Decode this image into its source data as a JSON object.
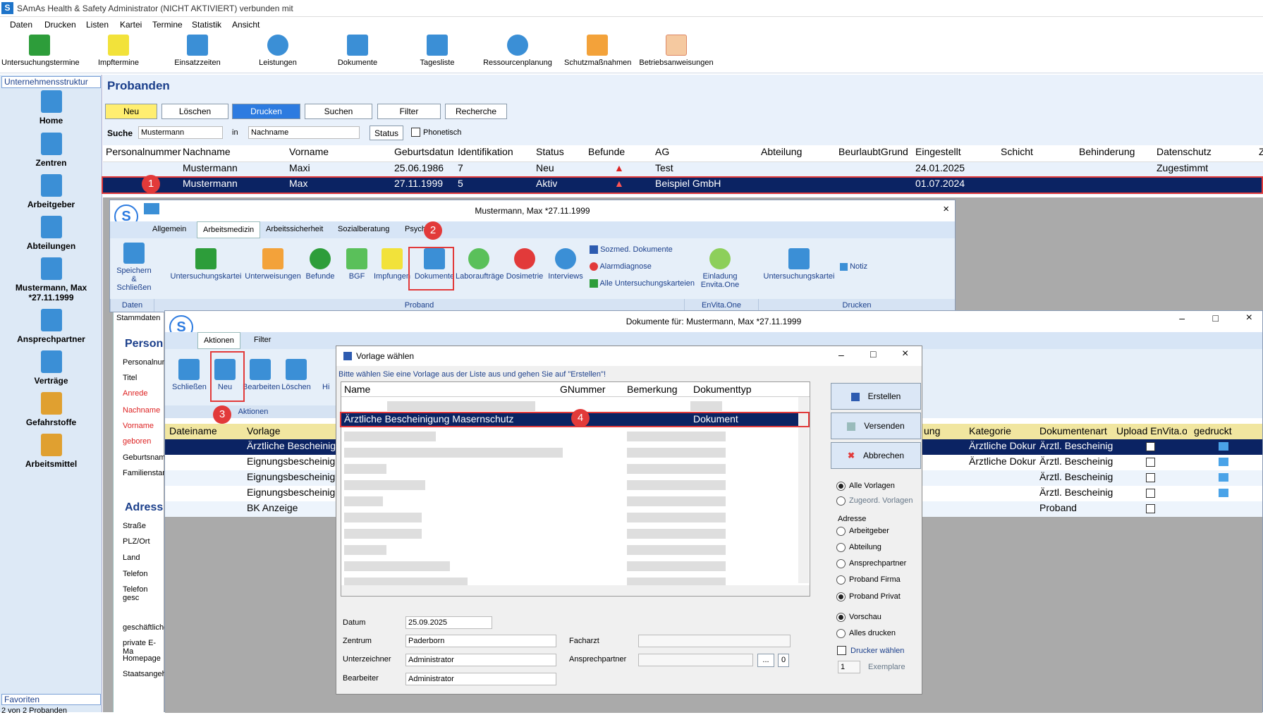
{
  "window": {
    "title": "SAmAs Health & Safety  Administrator (NICHT AKTIVIERT)  verbunden mit"
  },
  "menu": [
    "Daten",
    "Drucken",
    "Listen",
    "Kartei",
    "Termine",
    "Statistik",
    "Ansicht"
  ],
  "toolbar": [
    "Untersuchungstermine",
    "Impftermine",
    "Einsatzzeiten",
    "Leistungen",
    "Dokumente",
    "Tagesliste",
    "Ressourcenplanung",
    "Schutzmaßnahmen",
    "Betriebsanweisungen"
  ],
  "nav": {
    "header": "Unternehmensstruktur",
    "items": [
      "Home",
      "Zentren",
      "Arbeitgeber",
      "Abteilungen",
      "Mustermann, Max *27.11.1999",
      "Ansprechpartner",
      "Verträge",
      "Gefahrstoffe",
      "Arbeitsmittel"
    ],
    "favorites": "Favoriten",
    "status": "2 von 2 Probanden"
  },
  "probanden": {
    "title": "Probanden",
    "buttons": {
      "neu": "Neu",
      "loeschen": "Löschen",
      "drucken": "Drucken",
      "suchen": "Suchen",
      "filter": "Filter",
      "recherche": "Recherche"
    },
    "search": {
      "label": "Suche",
      "value": "Mustermann",
      "in_label": "in",
      "field": "Nachname",
      "status": "Status",
      "phonetisch": "Phonetisch"
    },
    "columns": [
      "Personalnummer",
      "Nachname",
      "Vorname",
      "Geburtsdatum",
      "Identifikation",
      "Status",
      "Befunde",
      "AG",
      "Abteilung",
      "BeurlaubtGrund",
      "Eingestellt",
      "Schicht",
      "Behinderung",
      "Datenschutz",
      "Z"
    ],
    "rows": [
      {
        "nachname": "Mustermann",
        "vorname": "Maxi",
        "geb": "25.06.1986",
        "id": "7",
        "status": "Neu",
        "ag": "Test",
        "eingestellt": "24.01.2025",
        "datenschutz": "Zugestimmt"
      },
      {
        "nachname": "Mustermann",
        "vorname": "Max",
        "geb": "27.11.1999",
        "id": "5",
        "status": "Aktiv",
        "ag": "Beispiel GmbH",
        "eingestellt": "01.07.2024",
        "datenschutz": ""
      }
    ]
  },
  "badges": [
    "1",
    "2",
    "3",
    "4"
  ],
  "patient_window": {
    "title": "Mustermann, Max *27.11.1999",
    "tabs": [
      "Allgemein",
      "Arbeitsmedizin",
      "Arbeitssicherheit",
      "Sozialberatung",
      "Psych"
    ],
    "buttons": [
      "Speichern & Schließen",
      "Untersuchungskartei",
      "Unterweisungen",
      "Befunde",
      "BGF",
      "Impfungen",
      "Dokumente",
      "Laboraufträge",
      "Dosimetrie",
      "Interviews"
    ],
    "side": [
      "Sozmed. Dokumente",
      "Alarmdiagnose",
      "Alle Untersuchungskarteien"
    ],
    "envita": "Einladung Envita.One",
    "kartei": "Untersuchungskartei",
    "notiz": "Notiz",
    "groups": [
      "Daten",
      "Proband",
      "EnVita.One",
      "Drucken"
    ],
    "stammdaten": "Stammdaten",
    "sections": [
      "Person",
      "Adress"
    ],
    "fields": [
      "Personalnum",
      "Titel",
      "Anrede",
      "Nachname",
      "Vorname",
      "geboren",
      "Geburtsname",
      "Familienstand",
      "Straße",
      "PLZ/Ort",
      "Land",
      "Telefon",
      "Telefon gesc",
      "geschäftliche",
      "private E-Ma",
      "Homepage",
      "Staatsangeh"
    ]
  },
  "doc_window": {
    "title": "Dokumente für: Mustermann, Max *27.11.1999",
    "tabs": [
      "Aktionen",
      "Filter"
    ],
    "buttons": [
      "Schließen",
      "Neu",
      "Bearbeiten",
      "Löschen",
      "Hi"
    ],
    "group": "Aktionen",
    "columns": [
      "Dateiname",
      "Vorlage",
      "ung",
      "Kategorie",
      "Dokumentenart",
      "Upload EnVita.or",
      "gedruckt"
    ],
    "rows": [
      {
        "vorlage": "Ärztliche Bescheinig",
        "kategorie": "Ärztliche Dokur",
        "art": "Ärztl. Bescheinig"
      },
      {
        "vorlage": "Eignungsbescheinig",
        "kategorie": "Ärztliche Dokur",
        "art": "Ärztl. Bescheinig"
      },
      {
        "vorlage": "Eignungsbescheinig",
        "kategorie": "",
        "art": "Ärztl. Bescheinig"
      },
      {
        "vorlage": "Eignungsbescheinig",
        "kategorie": "",
        "art": "Ärztl. Bescheinig"
      },
      {
        "vorlage": "BK Anzeige",
        "kategorie": "",
        "art": "Proband"
      }
    ]
  },
  "dialog": {
    "title": "Vorlage wählen",
    "hint": "Bitte wählen Sie eine Vorlage aus der Liste aus und gehen Sie auf \"Erstellen\"!",
    "columns": [
      "Name",
      "GNummer",
      "Bemerkung",
      "Dokumenttyp"
    ],
    "selected": {
      "name": "Ärztliche Bescheinigung Masernschutz",
      "typ": "Dokument"
    },
    "actions": [
      "Erstellen",
      "Versenden",
      "Abbrechen"
    ],
    "filter": [
      "Alle Vorlagen",
      "Zugeord. Vorlagen"
    ],
    "adresse_label": "Adresse",
    "adresse": [
      "Arbeitgeber",
      "Abteilung",
      "Ansprechpartner",
      "Proband Firma",
      "Proband Privat"
    ],
    "output": [
      "Vorschau",
      "Alles drucken",
      "Drucker wählen"
    ],
    "exemplare_label": "Exemplare",
    "exemplare": "1",
    "form": {
      "datum_label": "Datum",
      "datum": "25.09.2025",
      "zentrum_label": "Zentrum",
      "zentrum": "Paderborn",
      "unterzeichner_label": "Unterzeichner",
      "unterzeichner": "Administrator",
      "bearbeiter_label": "Bearbeiter",
      "bearbeiter": "Administrator",
      "facharzt_label": "Facharzt",
      "ansprech_label": "Ansprechpartner",
      "ansprech_btn": "...",
      "ansprech_count": "0"
    }
  }
}
